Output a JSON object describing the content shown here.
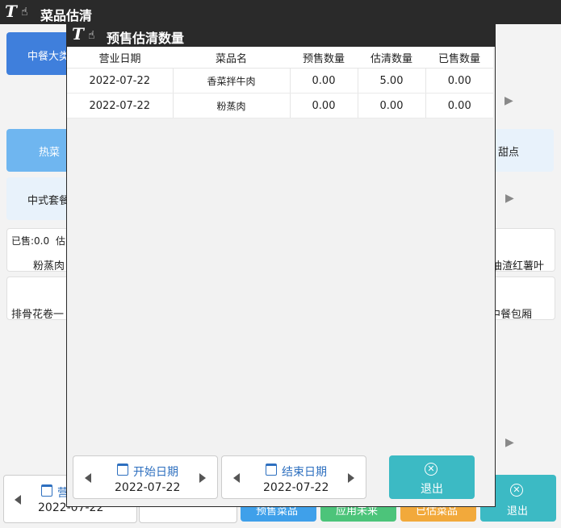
{
  "window": {
    "title": "菜品估清"
  },
  "background": {
    "category_main": "中餐大类",
    "cat_hot": "热菜",
    "cat_dessert": "甜点",
    "cat_set": "中式套餐",
    "item_sold_prefix": "已售:0.0",
    "item_est_prefix": "估",
    "item1": "粉蒸肉",
    "item2": "油渣红薯叶",
    "item3": "排骨花卷一",
    "item4": "中餐包厢",
    "bottom_date_label": "营",
    "bottom_date_value": "2022-07-22",
    "btn_presale": "预售菜品",
    "btn_apply_future": "应用未来",
    "btn_estimated": "已估菜品",
    "btn_exit": "退出"
  },
  "dialog": {
    "title": "预售估清数量",
    "columns": [
      "营业日期",
      "菜品名",
      "预售数量",
      "估清数量",
      "已售数量"
    ],
    "rows": [
      [
        "2022-07-22",
        "香菜拌牛肉",
        "0.00",
        "5.00",
        "0.00"
      ],
      [
        "2022-07-22",
        "粉蒸肉",
        "0.00",
        "0.00",
        "0.00"
      ]
    ],
    "start_date_label": "开始日期",
    "start_date_value": "2022-07-22",
    "end_date_label": "结束日期",
    "end_date_value": "2022-07-22",
    "exit_label": "退出"
  }
}
